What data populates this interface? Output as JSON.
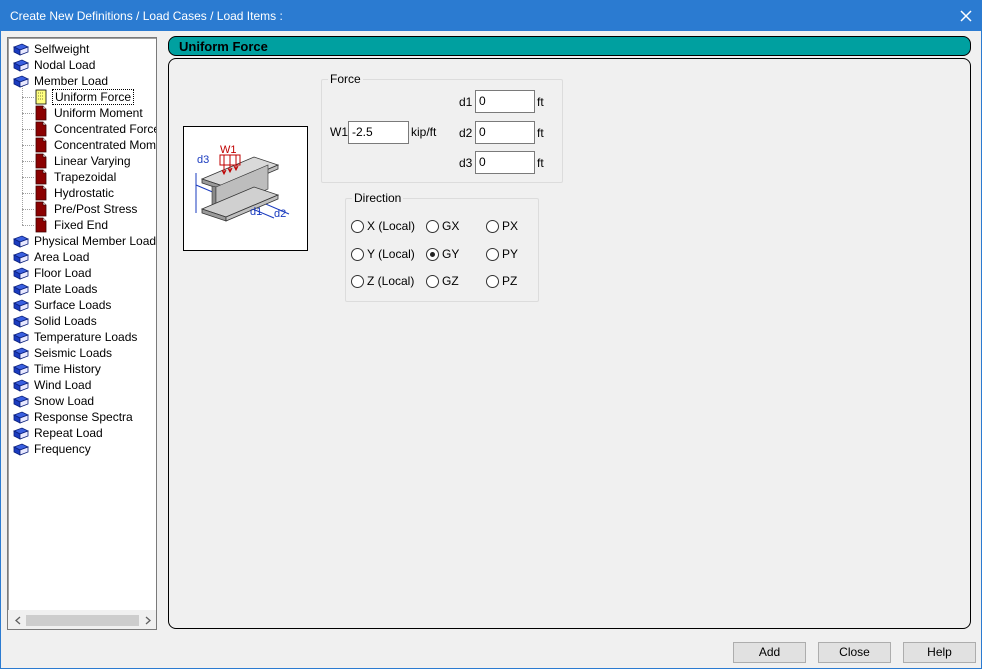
{
  "window": {
    "title": "Create New Definitions / Load Cases / Load Items :"
  },
  "tree": {
    "items": [
      {
        "label": "Selfweight",
        "icon": "book-icon",
        "level": 0
      },
      {
        "label": "Nodal Load",
        "icon": "book-icon",
        "level": 0
      },
      {
        "label": "Member Load",
        "icon": "book-icon",
        "level": 0
      },
      {
        "label": "Uniform Force",
        "icon": "page-selected-icon",
        "level": 1,
        "selected": true
      },
      {
        "label": "Uniform Moment",
        "icon": "page-icon",
        "level": 1
      },
      {
        "label": "Concentrated Force",
        "icon": "page-icon",
        "level": 1
      },
      {
        "label": "Concentrated Momen",
        "icon": "page-icon",
        "level": 1
      },
      {
        "label": "Linear Varying",
        "icon": "page-icon",
        "level": 1
      },
      {
        "label": "Trapezoidal",
        "icon": "page-icon",
        "level": 1
      },
      {
        "label": "Hydrostatic",
        "icon": "page-icon",
        "level": 1
      },
      {
        "label": "Pre/Post Stress",
        "icon": "page-icon",
        "level": 1
      },
      {
        "label": "Fixed End",
        "icon": "page-icon",
        "level": 1
      },
      {
        "label": "Physical Member Load",
        "icon": "book-icon",
        "level": 0
      },
      {
        "label": "Area Load",
        "icon": "book-icon",
        "level": 0
      },
      {
        "label": "Floor Load",
        "icon": "book-icon",
        "level": 0
      },
      {
        "label": "Plate Loads",
        "icon": "book-icon",
        "level": 0
      },
      {
        "label": "Surface Loads",
        "icon": "book-icon",
        "level": 0
      },
      {
        "label": "Solid Loads",
        "icon": "book-icon",
        "level": 0
      },
      {
        "label": "Temperature Loads",
        "icon": "book-icon",
        "level": 0
      },
      {
        "label": "Seismic Loads",
        "icon": "book-icon",
        "level": 0
      },
      {
        "label": "Time History",
        "icon": "book-icon",
        "level": 0
      },
      {
        "label": "Wind Load",
        "icon": "book-icon",
        "level": 0
      },
      {
        "label": "Snow Load",
        "icon": "book-icon",
        "level": 0
      },
      {
        "label": "Response Spectra",
        "icon": "book-icon",
        "level": 0
      },
      {
        "label": "Repeat Load",
        "icon": "book-icon",
        "level": 0
      },
      {
        "label": "Frequency",
        "icon": "book-icon",
        "level": 0
      }
    ]
  },
  "panel": {
    "header": "Uniform Force",
    "diagram": {
      "w1_label": "W1",
      "d1_label": "d1",
      "d2_label": "d2",
      "d3_label": "d3"
    },
    "force": {
      "title": "Force",
      "w1_label": "W1",
      "w1_value": "-2.5",
      "w1_unit": "kip/ft",
      "d1_label": "d1",
      "d1_value": "0",
      "d1_unit": "ft",
      "d2_label": "d2",
      "d2_value": "0",
      "d2_unit": "ft",
      "d3_label": "d3",
      "d3_value": "0",
      "d3_unit": "ft"
    },
    "direction": {
      "title": "Direction",
      "options": [
        {
          "label": "X (Local)",
          "checked": false
        },
        {
          "label": "GX",
          "checked": false
        },
        {
          "label": "PX",
          "checked": false
        },
        {
          "label": "Y (Local)",
          "checked": false
        },
        {
          "label": "GY",
          "checked": true
        },
        {
          "label": "PY",
          "checked": false
        },
        {
          "label": "Z (Local)",
          "checked": false
        },
        {
          "label": "GZ",
          "checked": false
        },
        {
          "label": "PZ",
          "checked": false
        }
      ]
    }
  },
  "buttons": {
    "add": "Add",
    "close": "Close",
    "help": "Help"
  },
  "colors": {
    "titlebar": "#2b7bd1",
    "header": "#00a0a0",
    "book": "#1a3bbf",
    "page": "#8b0000"
  }
}
